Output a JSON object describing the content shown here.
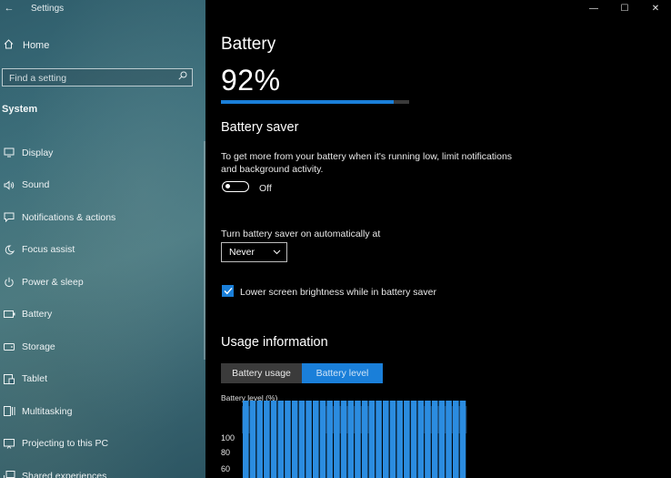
{
  "window": {
    "title": "Settings",
    "controls": [
      "minimize",
      "maximize",
      "close"
    ]
  },
  "sidebar": {
    "home_label": "Home",
    "search_placeholder": "Find a setting",
    "section_title": "System",
    "items": [
      {
        "label": "Display",
        "icon": "display-icon"
      },
      {
        "label": "Sound",
        "icon": "speaker-icon"
      },
      {
        "label": "Notifications & actions",
        "icon": "notification-icon"
      },
      {
        "label": "Focus assist",
        "icon": "moon-icon"
      },
      {
        "label": "Power & sleep",
        "icon": "power-icon"
      },
      {
        "label": "Battery",
        "icon": "battery-icon"
      },
      {
        "label": "Storage",
        "icon": "storage-icon"
      },
      {
        "label": "Tablet",
        "icon": "tablet-icon"
      },
      {
        "label": "Multitasking",
        "icon": "multitasking-icon"
      },
      {
        "label": "Projecting to this PC",
        "icon": "project-icon"
      },
      {
        "label": "Shared experiences",
        "icon": "shared-icon"
      }
    ]
  },
  "main": {
    "title": "Battery",
    "percent_text": "92%",
    "percent_value": 92,
    "saver": {
      "heading": "Battery saver",
      "description": "To get more from your battery when it's running low, limit notifications and background activity.",
      "toggle_state": "Off",
      "auto_label": "Turn battery saver on automatically at",
      "auto_value": "Never",
      "brightness_label": "Lower screen brightness while in battery saver",
      "brightness_checked": true
    },
    "usage": {
      "heading": "Usage information",
      "tabs": [
        {
          "label": "Battery usage",
          "active": false
        },
        {
          "label": "Battery level",
          "active": true
        }
      ]
    }
  },
  "colors": {
    "accent": "#1a7fd9",
    "bar_fill": "#1f6fc0",
    "bar_highlight": "#2b8ce0",
    "band": "#1a3550"
  },
  "chart_data": {
    "type": "bar",
    "title": "Battery level (%)",
    "y_ticks": [
      "100",
      "80",
      "60"
    ],
    "ylim": [
      0,
      110
    ],
    "values": [
      98,
      98,
      97,
      97,
      96,
      96,
      96,
      95,
      95,
      95,
      94,
      94,
      97,
      98,
      98,
      97,
      97,
      97,
      97,
      97,
      97,
      96,
      96,
      95,
      95,
      95,
      95,
      95,
      94,
      94,
      94,
      94
    ],
    "charging_bands": [
      [
        0,
        0
      ],
      [
        12,
        17
      ],
      [
        26,
        31
      ]
    ]
  }
}
